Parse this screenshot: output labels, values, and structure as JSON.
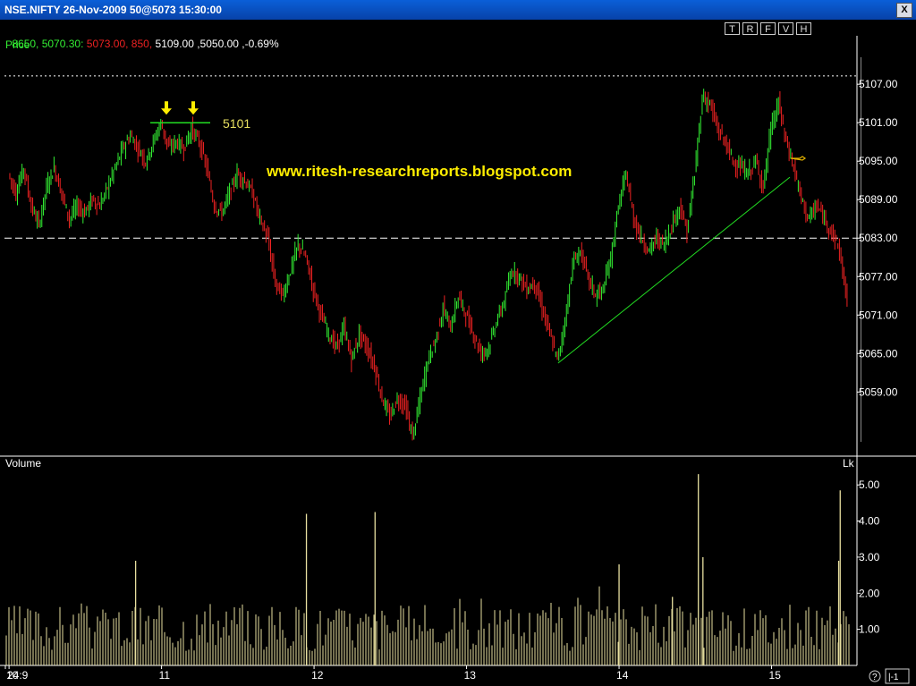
{
  "window": {
    "title": "NSE.NIFTY 26-Nov-2009 50@5073 15:30:00",
    "close_label": "X"
  },
  "info": {
    "part1": "8650, 5070.30:",
    "part2": "5073.00, 850,",
    "part3": "5109.00 ,5050.00 ,-0.69%"
  },
  "toolbar": {
    "buttons": [
      "T",
      "R",
      "F",
      "V",
      "H"
    ]
  },
  "colors": {
    "up": "#33ee33",
    "down": "#ee2222",
    "volume": "#e8e0a0",
    "trendline": "#22dd22",
    "watermark": "#ffee00",
    "grid": "#ffffff",
    "axis": "#ffffff"
  },
  "chart_data": {
    "type": "candlestick",
    "price_panel": {
      "label": "Price",
      "y_ticks": [
        5059.0,
        5065.0,
        5071.0,
        5077.0,
        5083.0,
        5089.0,
        5095.0,
        5101.0,
        5107.0
      ],
      "ylim": [
        5049,
        5114
      ],
      "reference_lines": [
        {
          "value": 5108.3,
          "style": "dotted"
        },
        {
          "value": 5083.0,
          "style": "dashed"
        }
      ],
      "annotation": {
        "text": "5101",
        "value": 5101
      },
      "watermark": "www.ritesh-researchreports.blogspot.com",
      "trendline": [
        {
          "x": 13.6,
          "y": 5063.5
        },
        {
          "x": 15.12,
          "y": 5092.5
        }
      ],
      "series": [
        {
          "x": 10.0,
          "y": 5093
        },
        {
          "x": 10.05,
          "y": 5090
        },
        {
          "x": 10.1,
          "y": 5094
        },
        {
          "x": 10.15,
          "y": 5088
        },
        {
          "x": 10.2,
          "y": 5085
        },
        {
          "x": 10.25,
          "y": 5091
        },
        {
          "x": 10.3,
          "y": 5094
        },
        {
          "x": 10.35,
          "y": 5090
        },
        {
          "x": 10.4,
          "y": 5086
        },
        {
          "x": 10.45,
          "y": 5088
        },
        {
          "x": 10.5,
          "y": 5087
        },
        {
          "x": 10.55,
          "y": 5089
        },
        {
          "x": 10.6,
          "y": 5088
        },
        {
          "x": 10.65,
          "y": 5091
        },
        {
          "x": 10.7,
          "y": 5094
        },
        {
          "x": 10.75,
          "y": 5097
        },
        {
          "x": 10.8,
          "y": 5099
        },
        {
          "x": 10.85,
          "y": 5097
        },
        {
          "x": 10.9,
          "y": 5095
        },
        {
          "x": 10.95,
          "y": 5098
        },
        {
          "x": 11.0,
          "y": 5101
        },
        {
          "x": 11.05,
          "y": 5097
        },
        {
          "x": 11.1,
          "y": 5098
        },
        {
          "x": 11.15,
          "y": 5097
        },
        {
          "x": 11.2,
          "y": 5100
        },
        {
          "x": 11.25,
          "y": 5098
        },
        {
          "x": 11.3,
          "y": 5094
        },
        {
          "x": 11.35,
          "y": 5088
        },
        {
          "x": 11.4,
          "y": 5087
        },
        {
          "x": 11.45,
          "y": 5090
        },
        {
          "x": 11.5,
          "y": 5093
        },
        {
          "x": 11.55,
          "y": 5092
        },
        {
          "x": 11.6,
          "y": 5090
        },
        {
          "x": 11.65,
          "y": 5086
        },
        {
          "x": 11.7,
          "y": 5083
        },
        {
          "x": 11.75,
          "y": 5076
        },
        {
          "x": 11.8,
          "y": 5074
        },
        {
          "x": 11.85,
          "y": 5078
        },
        {
          "x": 11.9,
          "y": 5082
        },
        {
          "x": 11.95,
          "y": 5080
        },
        {
          "x": 12.0,
          "y": 5075
        },
        {
          "x": 12.05,
          "y": 5071
        },
        {
          "x": 12.1,
          "y": 5068
        },
        {
          "x": 12.15,
          "y": 5066
        },
        {
          "x": 12.2,
          "y": 5069
        },
        {
          "x": 12.25,
          "y": 5064
        },
        {
          "x": 12.3,
          "y": 5068
        },
        {
          "x": 12.35,
          "y": 5066
        },
        {
          "x": 12.4,
          "y": 5063
        },
        {
          "x": 12.45,
          "y": 5058
        },
        {
          "x": 12.5,
          "y": 5055
        },
        {
          "x": 12.55,
          "y": 5058
        },
        {
          "x": 12.6,
          "y": 5057
        },
        {
          "x": 12.65,
          "y": 5052
        },
        {
          "x": 12.7,
          "y": 5058
        },
        {
          "x": 12.75,
          "y": 5064
        },
        {
          "x": 12.8,
          "y": 5067
        },
        {
          "x": 12.85,
          "y": 5072
        },
        {
          "x": 12.9,
          "y": 5069
        },
        {
          "x": 12.95,
          "y": 5074
        },
        {
          "x": 13.0,
          "y": 5071
        },
        {
          "x": 13.05,
          "y": 5068
        },
        {
          "x": 13.1,
          "y": 5065
        },
        {
          "x": 13.15,
          "y": 5066
        },
        {
          "x": 13.2,
          "y": 5070
        },
        {
          "x": 13.25,
          "y": 5073
        },
        {
          "x": 13.3,
          "y": 5078
        },
        {
          "x": 13.35,
          "y": 5077
        },
        {
          "x": 13.4,
          "y": 5075
        },
        {
          "x": 13.45,
          "y": 5076
        },
        {
          "x": 13.5,
          "y": 5072
        },
        {
          "x": 13.55,
          "y": 5068
        },
        {
          "x": 13.6,
          "y": 5064
        },
        {
          "x": 13.65,
          "y": 5070
        },
        {
          "x": 13.7,
          "y": 5079
        },
        {
          "x": 13.75,
          "y": 5081
        },
        {
          "x": 13.8,
          "y": 5077
        },
        {
          "x": 13.85,
          "y": 5074
        },
        {
          "x": 13.9,
          "y": 5075
        },
        {
          "x": 13.95,
          "y": 5080
        },
        {
          "x": 14.0,
          "y": 5088
        },
        {
          "x": 14.05,
          "y": 5093
        },
        {
          "x": 14.1,
          "y": 5086
        },
        {
          "x": 14.15,
          "y": 5083
        },
        {
          "x": 14.2,
          "y": 5081
        },
        {
          "x": 14.25,
          "y": 5083
        },
        {
          "x": 14.3,
          "y": 5082
        },
        {
          "x": 14.35,
          "y": 5085
        },
        {
          "x": 14.4,
          "y": 5088
        },
        {
          "x": 14.45,
          "y": 5084
        },
        {
          "x": 14.5,
          "y": 5093
        },
        {
          "x": 14.55,
          "y": 5105
        },
        {
          "x": 14.6,
          "y": 5104
        },
        {
          "x": 14.65,
          "y": 5100
        },
        {
          "x": 14.7,
          "y": 5098
        },
        {
          "x": 14.75,
          "y": 5095
        },
        {
          "x": 14.8,
          "y": 5094
        },
        {
          "x": 14.85,
          "y": 5093
        },
        {
          "x": 14.9,
          "y": 5095
        },
        {
          "x": 14.95,
          "y": 5091
        },
        {
          "x": 15.0,
          "y": 5100
        },
        {
          "x": 15.05,
          "y": 5104
        },
        {
          "x": 15.1,
          "y": 5098
        },
        {
          "x": 15.15,
          "y": 5094
        },
        {
          "x": 15.2,
          "y": 5089
        },
        {
          "x": 15.25,
          "y": 5086
        },
        {
          "x": 15.3,
          "y": 5088
        },
        {
          "x": 15.35,
          "y": 5086
        },
        {
          "x": 15.4,
          "y": 5084
        },
        {
          "x": 15.45,
          "y": 5081
        },
        {
          "x": 15.5,
          "y": 5073
        }
      ]
    },
    "volume_panel": {
      "label": "Volume",
      "unit_label": "Lk",
      "y_ticks": [
        1.0,
        2.0,
        3.0,
        4.0,
        5.0
      ],
      "ylim": [
        0,
        5.6
      ],
      "spikes": [
        {
          "x": 10.83,
          "v": 2.9
        },
        {
          "x": 11.95,
          "v": 4.2
        },
        {
          "x": 12.4,
          "v": 4.25
        },
        {
          "x": 14.0,
          "v": 2.8
        },
        {
          "x": 14.35,
          "v": 1.9
        },
        {
          "x": 14.52,
          "v": 5.3
        },
        {
          "x": 14.55,
          "v": 3.0
        },
        {
          "x": 15.45,
          "v": 4.85
        },
        {
          "x": 15.44,
          "v": 2.9
        }
      ]
    },
    "x_ticks": [
      {
        "label": "24:9",
        "x": 9.9
      },
      {
        "label": "10",
        "x": 10.0
      },
      {
        "label": "11",
        "x": 11.0
      },
      {
        "label": "12",
        "x": 12.0
      },
      {
        "label": "13",
        "x": 13.0
      },
      {
        "label": "14",
        "x": 14.0
      },
      {
        "label": "15",
        "x": 15.0
      }
    ],
    "xlim": [
      9.97,
      15.56
    ],
    "status": {
      "help": "?",
      "scroll": "|-1"
    }
  }
}
